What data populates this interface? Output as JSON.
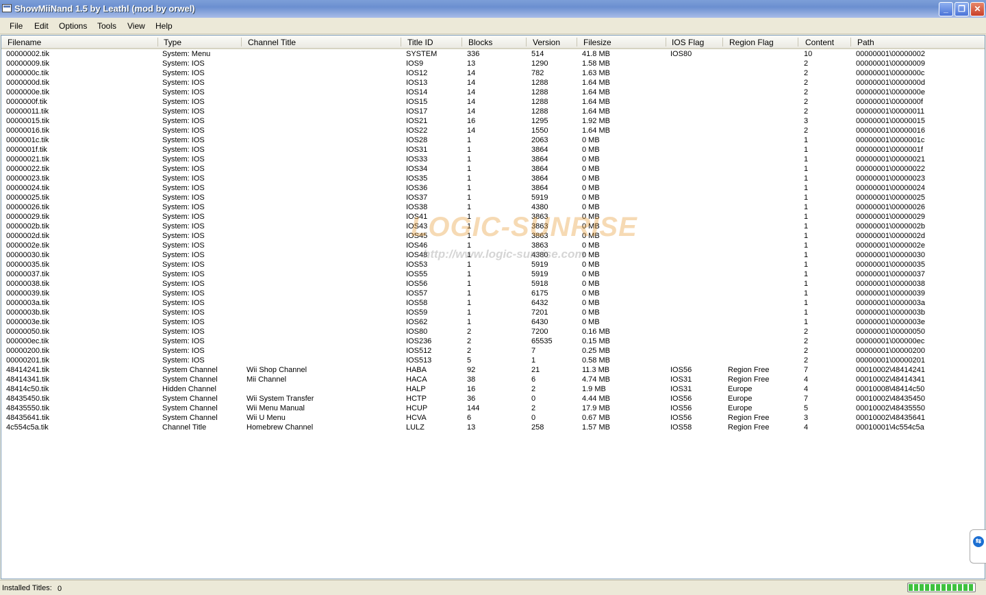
{
  "window": {
    "title": "ShowMiiNand 1.5 by Leathl (mod by orwel)",
    "controls": {
      "minimize": "_",
      "restore": "❐",
      "close": "✕"
    }
  },
  "menu": [
    "File",
    "Edit",
    "Options",
    "Tools",
    "View",
    "Help"
  ],
  "columns": [
    "Filename",
    "Type",
    "Channel Title",
    "Title ID",
    "Blocks",
    "Version",
    "Filesize",
    "IOS Flag",
    "Region Flag",
    "Content",
    "Path"
  ],
  "rows": [
    [
      "00000002.tik",
      "System: Menu",
      "",
      "SYSTEM",
      "336",
      "514",
      "41.8 MB",
      "IOS80",
      "",
      "10",
      "00000001\\00000002"
    ],
    [
      "00000009.tik",
      "System: IOS",
      "",
      "IOS9",
      "13",
      "1290",
      "1.58 MB",
      "",
      "",
      "2",
      "00000001\\00000009"
    ],
    [
      "0000000c.tik",
      "System: IOS",
      "",
      "IOS12",
      "14",
      "782",
      "1.63 MB",
      "",
      "",
      "2",
      "00000001\\0000000c"
    ],
    [
      "0000000d.tik",
      "System: IOS",
      "",
      "IOS13",
      "14",
      "1288",
      "1.64 MB",
      "",
      "",
      "2",
      "00000001\\0000000d"
    ],
    [
      "0000000e.tik",
      "System: IOS",
      "",
      "IOS14",
      "14",
      "1288",
      "1.64 MB",
      "",
      "",
      "2",
      "00000001\\0000000e"
    ],
    [
      "0000000f.tik",
      "System: IOS",
      "",
      "IOS15",
      "14",
      "1288",
      "1.64 MB",
      "",
      "",
      "2",
      "00000001\\0000000f"
    ],
    [
      "00000011.tik",
      "System: IOS",
      "",
      "IOS17",
      "14",
      "1288",
      "1.64 MB",
      "",
      "",
      "2",
      "00000001\\00000011"
    ],
    [
      "00000015.tik",
      "System: IOS",
      "",
      "IOS21",
      "16",
      "1295",
      "1.92 MB",
      "",
      "",
      "3",
      "00000001\\00000015"
    ],
    [
      "00000016.tik",
      "System: IOS",
      "",
      "IOS22",
      "14",
      "1550",
      "1.64 MB",
      "",
      "",
      "2",
      "00000001\\00000016"
    ],
    [
      "0000001c.tik",
      "System: IOS",
      "",
      "IOS28",
      "1",
      "2063",
      "0 MB",
      "",
      "",
      "1",
      "00000001\\0000001c"
    ],
    [
      "0000001f.tik",
      "System: IOS",
      "",
      "IOS31",
      "1",
      "3864",
      "0 MB",
      "",
      "",
      "1",
      "00000001\\0000001f"
    ],
    [
      "00000021.tik",
      "System: IOS",
      "",
      "IOS33",
      "1",
      "3864",
      "0 MB",
      "",
      "",
      "1",
      "00000001\\00000021"
    ],
    [
      "00000022.tik",
      "System: IOS",
      "",
      "IOS34",
      "1",
      "3864",
      "0 MB",
      "",
      "",
      "1",
      "00000001\\00000022"
    ],
    [
      "00000023.tik",
      "System: IOS",
      "",
      "IOS35",
      "1",
      "3864",
      "0 MB",
      "",
      "",
      "1",
      "00000001\\00000023"
    ],
    [
      "00000024.tik",
      "System: IOS",
      "",
      "IOS36",
      "1",
      "3864",
      "0 MB",
      "",
      "",
      "1",
      "00000001\\00000024"
    ],
    [
      "00000025.tik",
      "System: IOS",
      "",
      "IOS37",
      "1",
      "5919",
      "0 MB",
      "",
      "",
      "1",
      "00000001\\00000025"
    ],
    [
      "00000026.tik",
      "System: IOS",
      "",
      "IOS38",
      "1",
      "4380",
      "0 MB",
      "",
      "",
      "1",
      "00000001\\00000026"
    ],
    [
      "00000029.tik",
      "System: IOS",
      "",
      "IOS41",
      "1",
      "3863",
      "0 MB",
      "",
      "",
      "1",
      "00000001\\00000029"
    ],
    [
      "0000002b.tik",
      "System: IOS",
      "",
      "IOS43",
      "1",
      "3863",
      "0 MB",
      "",
      "",
      "1",
      "00000001\\0000002b"
    ],
    [
      "0000002d.tik",
      "System: IOS",
      "",
      "IOS45",
      "1",
      "3863",
      "0 MB",
      "",
      "",
      "1",
      "00000001\\0000002d"
    ],
    [
      "0000002e.tik",
      "System: IOS",
      "",
      "IOS46",
      "1",
      "3863",
      "0 MB",
      "",
      "",
      "1",
      "00000001\\0000002e"
    ],
    [
      "00000030.tik",
      "System: IOS",
      "",
      "IOS48",
      "1",
      "4380",
      "0 MB",
      "",
      "",
      "1",
      "00000001\\00000030"
    ],
    [
      "00000035.tik",
      "System: IOS",
      "",
      "IOS53",
      "1",
      "5919",
      "0 MB",
      "",
      "",
      "1",
      "00000001\\00000035"
    ],
    [
      "00000037.tik",
      "System: IOS",
      "",
      "IOS55",
      "1",
      "5919",
      "0 MB",
      "",
      "",
      "1",
      "00000001\\00000037"
    ],
    [
      "00000038.tik",
      "System: IOS",
      "",
      "IOS56",
      "1",
      "5918",
      "0 MB",
      "",
      "",
      "1",
      "00000001\\00000038"
    ],
    [
      "00000039.tik",
      "System: IOS",
      "",
      "IOS57",
      "1",
      "6175",
      "0 MB",
      "",
      "",
      "1",
      "00000001\\00000039"
    ],
    [
      "0000003a.tik",
      "System: IOS",
      "",
      "IOS58",
      "1",
      "6432",
      "0 MB",
      "",
      "",
      "1",
      "00000001\\0000003a"
    ],
    [
      "0000003b.tik",
      "System: IOS",
      "",
      "IOS59",
      "1",
      "7201",
      "0 MB",
      "",
      "",
      "1",
      "00000001\\0000003b"
    ],
    [
      "0000003e.tik",
      "System: IOS",
      "",
      "IOS62",
      "1",
      "6430",
      "0 MB",
      "",
      "",
      "1",
      "00000001\\0000003e"
    ],
    [
      "00000050.tik",
      "System: IOS",
      "",
      "IOS80",
      "2",
      "7200",
      "0.16 MB",
      "",
      "",
      "2",
      "00000001\\00000050"
    ],
    [
      "000000ec.tik",
      "System: IOS",
      "",
      "IOS236",
      "2",
      "65535",
      "0.15 MB",
      "",
      "",
      "2",
      "00000001\\000000ec"
    ],
    [
      "00000200.tik",
      "System: IOS",
      "",
      "IOS512",
      "2",
      "7",
      "0.25 MB",
      "",
      "",
      "2",
      "00000001\\00000200"
    ],
    [
      "00000201.tik",
      "System: IOS",
      "",
      "IOS513",
      "5",
      "1",
      "0.58 MB",
      "",
      "",
      "2",
      "00000001\\00000201"
    ],
    [
      "48414241.tik",
      "System Channel",
      "Wii Shop Channel",
      "HABA",
      "92",
      "21",
      "11.3 MB",
      "IOS56",
      "Region Free",
      "7",
      "00010002\\48414241"
    ],
    [
      "48414341.tik",
      "System Channel",
      "Mii Channel",
      "HACA",
      "38",
      "6",
      "4.74 MB",
      "IOS31",
      "Region Free",
      "4",
      "00010002\\48414341"
    ],
    [
      "48414c50.tik",
      "Hidden Channel",
      "",
      "HALP",
      "16",
      "2",
      "1.9 MB",
      "IOS31",
      "Europe",
      "4",
      "00010008\\48414c50"
    ],
    [
      "48435450.tik",
      "System Channel",
      "Wii System Transfer",
      "HCTP",
      "36",
      "0",
      "4.44 MB",
      "IOS56",
      "Europe",
      "7",
      "00010002\\48435450"
    ],
    [
      "48435550.tik",
      "System Channel",
      "Wii Menu Manual",
      "HCUP",
      "144",
      "2",
      "17.9 MB",
      "IOS56",
      "Europe",
      "5",
      "00010002\\48435550"
    ],
    [
      "48435641.tik",
      "System Channel",
      "Wii U Menu",
      "HCVA",
      "6",
      "0",
      "0.67 MB",
      "IOS56",
      "Region Free",
      "3",
      "00010002\\48435641"
    ],
    [
      "4c554c5a.tik",
      "Channel Title",
      "Homebrew Channel",
      "LULZ",
      "13",
      "258",
      "1.57 MB",
      "IOS58",
      "Region Free",
      "4",
      "00010001\\4c554c5a"
    ]
  ],
  "watermark": {
    "big": "LOGIC-SUNRISE",
    "small": "http://www.logic-sunrise.com"
  },
  "sidebar_tab_icon": "teamviewer-icon",
  "status": {
    "label": "Installed Titles:",
    "value": "0",
    "progress_percent": 100
  },
  "colors": {
    "title_bar": "#7d9fd8",
    "progress": "#3fc13f",
    "window": "#ece9d8"
  }
}
